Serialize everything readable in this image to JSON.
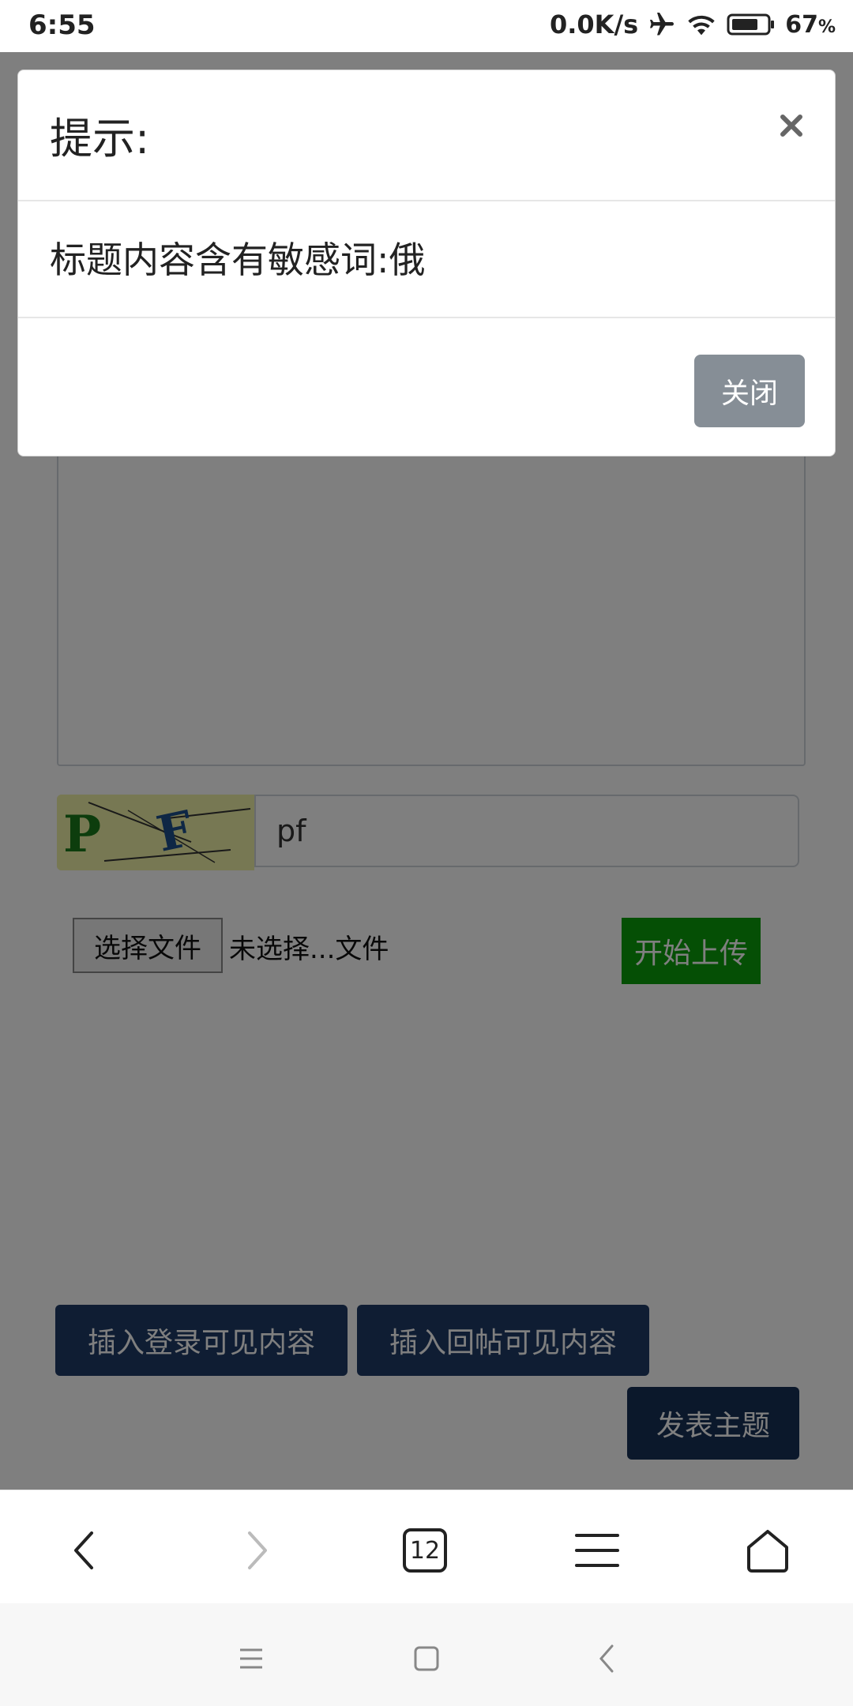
{
  "status_bar": {
    "time": "6:55",
    "network_speed": "0.0K/s",
    "battery_percent": "67",
    "battery_unit": "%",
    "icons": [
      "airplane-icon",
      "wifi-icon",
      "battery-icon"
    ]
  },
  "page": {
    "captcha_value": "pf",
    "captcha_image_text": "PF",
    "file_button_label": "选择文件",
    "file_status": "未选择...文件",
    "upload_button_label": "开始上传",
    "insert_login_label": "插入登录可见内容",
    "insert_reply_label": "插入回帖可见内容",
    "post_button_label": "发表主题"
  },
  "modal": {
    "title": "提示:",
    "message": "标题内容含有敏感词:俄",
    "close_button_label": "关闭",
    "close_icon": "close-icon"
  },
  "browser_bar": {
    "tab_count": "12",
    "icons": [
      "back-icon",
      "forward-icon",
      "tabs-icon",
      "menu-icon",
      "home-icon"
    ]
  },
  "system_nav": {
    "icons": [
      "recent-apps-icon",
      "home-square-icon",
      "system-back-icon"
    ]
  },
  "colors": {
    "upload_green": "#0a9e0a",
    "dark_button": "#1f3b66",
    "modal_close_button": "#868e96",
    "overlay": "rgba(0,0,0,0.5)"
  }
}
